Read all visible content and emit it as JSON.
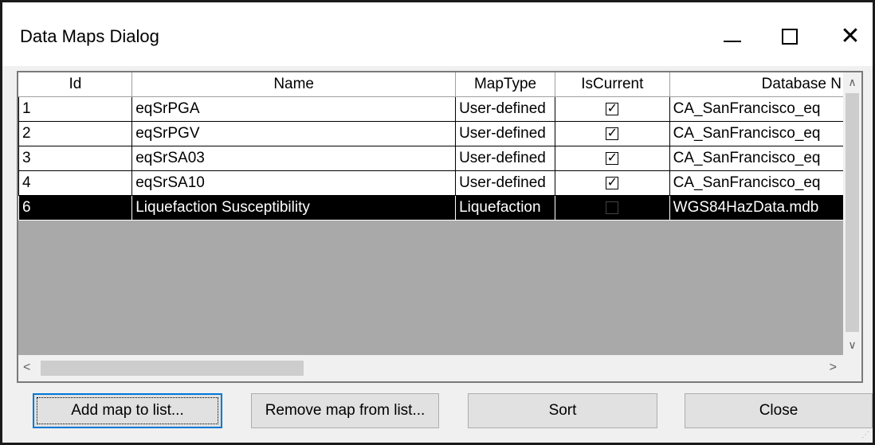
{
  "window": {
    "title": "Data Maps Dialog",
    "minimize": "—",
    "close": "✕"
  },
  "grid": {
    "columns": [
      "Id",
      "Name",
      "MapType",
      "IsCurrent",
      "Database N"
    ],
    "rows": [
      {
        "id": "1",
        "name": "eqSrPGA",
        "maptype": "User-defined",
        "iscurrent": true,
        "database": "CA_SanFrancisco_eq",
        "selected": false
      },
      {
        "id": "2",
        "name": "eqSrPGV",
        "maptype": "User-defined",
        "iscurrent": true,
        "database": "CA_SanFrancisco_eq",
        "selected": false
      },
      {
        "id": "3",
        "name": "eqSrSA03",
        "maptype": "User-defined",
        "iscurrent": true,
        "database": "CA_SanFrancisco_eq",
        "selected": false
      },
      {
        "id": "4",
        "name": "eqSrSA10",
        "maptype": "User-defined",
        "iscurrent": true,
        "database": "CA_SanFrancisco_eq",
        "selected": false
      },
      {
        "id": "6",
        "name": "Liquefaction Susceptibility",
        "maptype": "Liquefaction",
        "iscurrent": false,
        "database": "WGS84HazData.mdb",
        "selected": true
      }
    ],
    "scroll_up_icon": "chevron-up-icon",
    "scroll_down_icon": "chevron-down-icon",
    "scroll_left_icon": "chevron-left-icon",
    "scroll_right_icon": "chevron-right-icon"
  },
  "buttons": {
    "add": "Add map to list...",
    "remove": "Remove map from list...",
    "sort": "Sort",
    "close": "Close"
  },
  "colors": {
    "selected_row_bg": "#000000",
    "focus_border": "#0078d7",
    "grid_background": "#a9a9a9"
  }
}
